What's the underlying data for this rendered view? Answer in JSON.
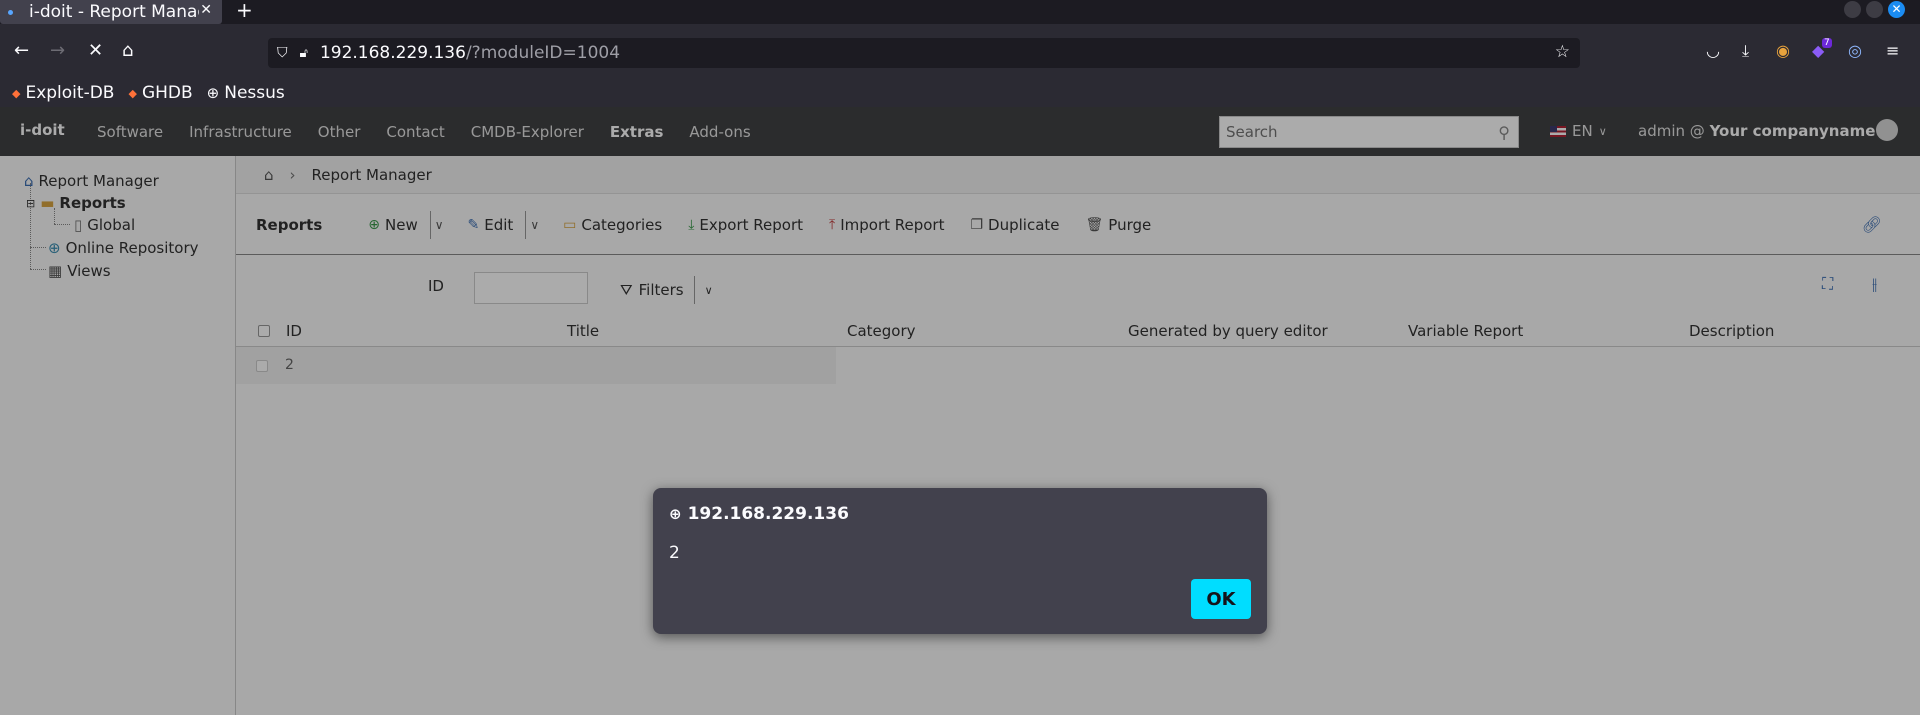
{
  "browser": {
    "tab_title": "i-doit - Report Manag",
    "new_tab": "+",
    "url_host": "192.168.229.136",
    "url_path": "/?moduleID=1004",
    "bookmarks": [
      {
        "label": "Exploit-DB",
        "icon": "kali-dragon-icon"
      },
      {
        "label": "GHDB",
        "icon": "kali-dragon-icon"
      },
      {
        "label": "Nessus",
        "icon": "globe-icon"
      }
    ],
    "extension_badge": "7"
  },
  "app": {
    "logo": "i-doit",
    "menu": [
      {
        "label": "Software",
        "active": false
      },
      {
        "label": "Infrastructure",
        "active": false
      },
      {
        "label": "Other",
        "active": false
      },
      {
        "label": "Contact",
        "active": false
      },
      {
        "label": "CMDB-Explorer",
        "active": false
      },
      {
        "label": "Extras",
        "active": true
      },
      {
        "label": "Add-ons",
        "active": false
      }
    ],
    "search_placeholder": "Search",
    "language": "EN",
    "user_prefix": "admin @",
    "user_company": "Your companyname"
  },
  "sidebar": {
    "items": [
      {
        "label": "Report Manager",
        "icon": "home-icon"
      },
      {
        "label": "Reports",
        "icon": "folder-icon"
      },
      {
        "label": "Global",
        "icon": "file-icon"
      },
      {
        "label": "Online Repository",
        "icon": "globe-icon"
      },
      {
        "label": "Views",
        "icon": "table-icon"
      }
    ]
  },
  "breadcrumb": {
    "current": "Report Manager"
  },
  "toolbar": {
    "title": "Reports",
    "buttons": [
      "New",
      "Edit",
      "Categories",
      "Export Report",
      "Import Report",
      "Duplicate",
      "Purge"
    ]
  },
  "filter": {
    "id_label": "ID",
    "filters_label": "Filters"
  },
  "table": {
    "columns": [
      "ID",
      "Title",
      "Category",
      "Generated by query editor",
      "Variable Report",
      "Description"
    ],
    "rows": [
      {
        "id": "2"
      }
    ]
  },
  "dialog": {
    "title": "192.168.229.136",
    "message": "2",
    "ok_label": "OK"
  },
  "colors": {
    "accent": "#00ddff",
    "topnav": "#414244",
    "link": "#3d6fb3"
  }
}
